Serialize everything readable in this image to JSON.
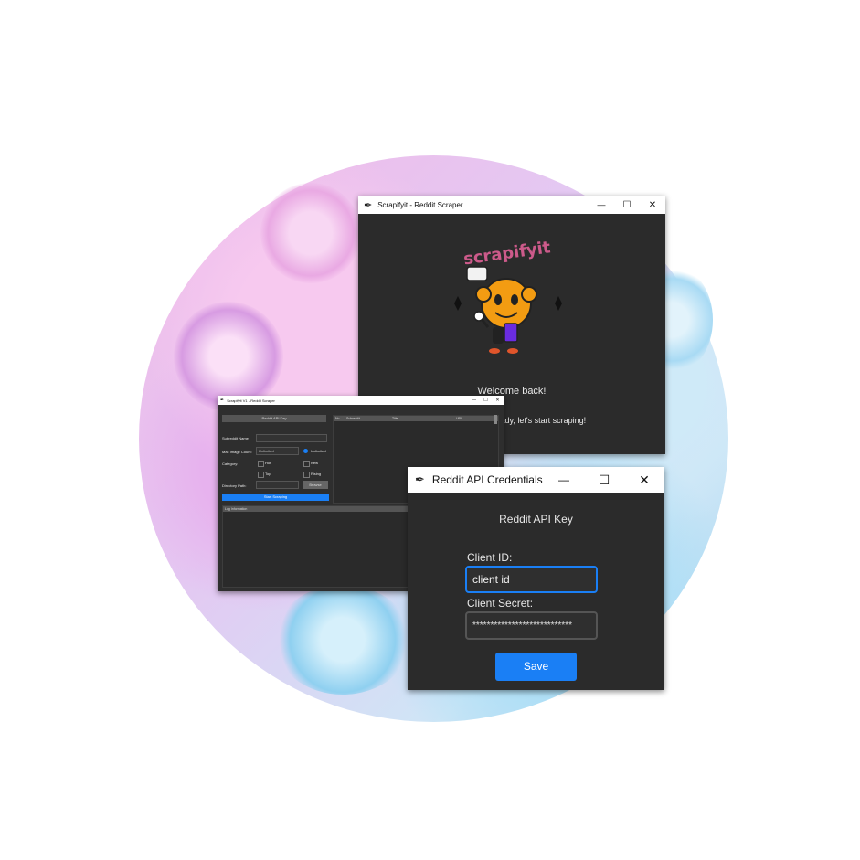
{
  "main_window": {
    "title": "Scrapifyit - Reddit Scraper",
    "welcome": "Welcome back!",
    "subtitle": "Ready, let's start scraping!",
    "logo_text": "scrapifyit"
  },
  "scraper_window": {
    "title": "Scrapifyit V1 - Reddit Scraper",
    "api_key_button": "Reddit API Key",
    "subreddit_label": "Subreddit Name :",
    "max_count_label": "Max Image Count:",
    "max_count_value": "Unlimited",
    "unlimited_label": "Unlimited",
    "category_label": "Category:",
    "categories": [
      "Hot",
      "New",
      "Top",
      "Rising"
    ],
    "directory_label": "Directory Path:",
    "browse_button": "Browse",
    "start_button": "Start Scraping",
    "table_headers": [
      "No.",
      "Subreddit",
      "Title",
      "URL"
    ],
    "log_header": "Log Information"
  },
  "dialog": {
    "title": "Reddit API Credentials",
    "heading": "Reddit API Key",
    "client_id_label": "Client ID:",
    "client_id_value": "client id",
    "client_secret_label": "Client Secret:",
    "client_secret_value": "****************************",
    "save_button": "Save",
    "accent": "#1a7ff5"
  },
  "window_controls": {
    "minimize": "—",
    "maximize": "☐",
    "close": "✕"
  }
}
